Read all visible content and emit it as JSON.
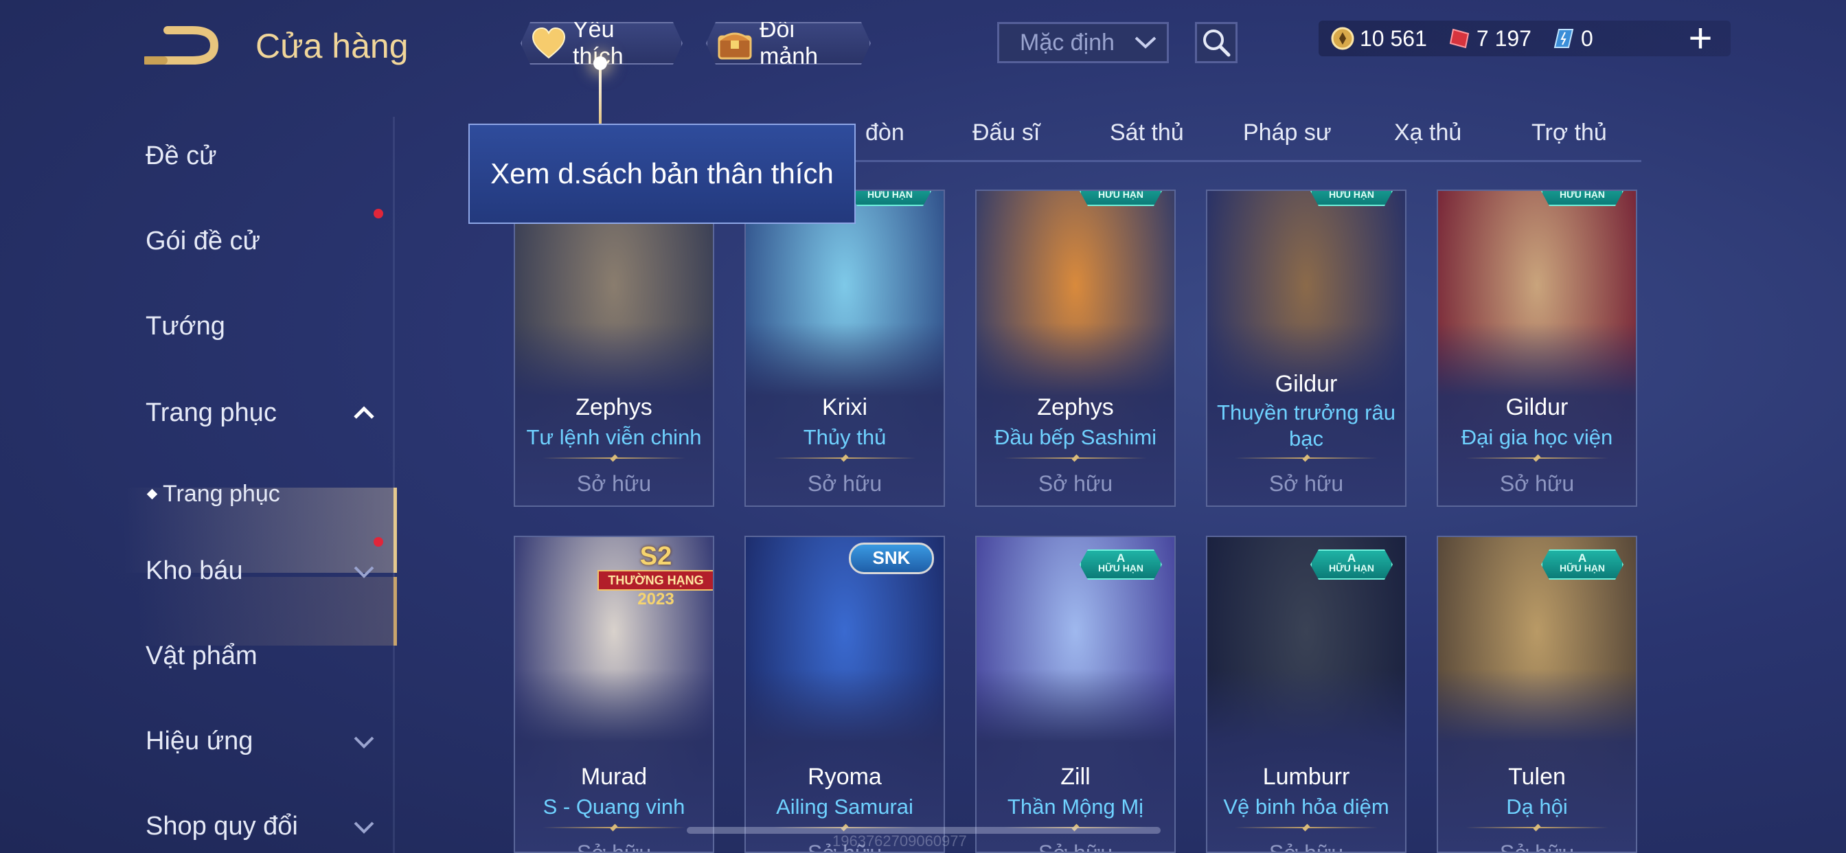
{
  "header": {
    "title": "Cửa hàng",
    "favorites_label": "Yêu thích",
    "exchange_label": "Đổi mảnh",
    "sort_value": "Mặc định"
  },
  "currency": {
    "gold": "10 561",
    "vouchers": "7 197",
    "tokens": "0"
  },
  "sidebar": {
    "items": [
      {
        "label": "Đề cử"
      },
      {
        "label": "Gói đề cử"
      },
      {
        "label": "Tướng"
      },
      {
        "label": "Trang phục"
      },
      {
        "label": "Trang phục"
      },
      {
        "label": "Kho báu"
      },
      {
        "label": "Vật phẩm"
      },
      {
        "label": "Hiệu ứng"
      },
      {
        "label": "Shop quy đổi"
      }
    ]
  },
  "tabs": [
    {
      "label": "đòn"
    },
    {
      "label": "Đấu sĩ"
    },
    {
      "label": "Sát thủ"
    },
    {
      "label": "Pháp sư"
    },
    {
      "label": "Xạ thủ"
    },
    {
      "label": "Trợ thủ"
    }
  ],
  "tooltip": {
    "text": "Xem d.sách bản thân thích"
  },
  "badges": {
    "limited_top": "A",
    "limited_bottom": "HỮU HẠN",
    "event_line1": "S2",
    "event_line2": "THƯỜNG HẠNG",
    "event_line3": "2023",
    "snk": "SNK"
  },
  "cards": [
    {
      "hero": "Zephys",
      "skin": "Tư lệnh viễn chinh",
      "status": "Sở hữu",
      "art": [
        "#8a7d6e",
        "#3a3f55"
      ]
    },
    {
      "hero": "Krixi",
      "skin": "Thủy thủ",
      "status": "Sở hữu",
      "art": [
        "#7ec9e8",
        "#33558e"
      ]
    },
    {
      "hero": "Zephys",
      "skin": "Đầu bếp Sashimi",
      "status": "Sở hữu",
      "art": [
        "#d98a3c",
        "#3b3f66"
      ]
    },
    {
      "hero": "Gildur",
      "skin": "Thuyền trưởng râu bạc",
      "status": "Sở hữu",
      "art": [
        "#8b6a4a",
        "#2b3366"
      ]
    },
    {
      "hero": "Gildur",
      "skin": "Đại gia học viện",
      "status": "Sở hữu",
      "art": [
        "#c9a47c",
        "#7a2a3a"
      ]
    },
    {
      "hero": "Murad",
      "skin": "S - Quang vinh",
      "status": "Sở hữu",
      "art": [
        "#d9d2cc",
        "#3a3f77"
      ]
    },
    {
      "hero": "Ryoma",
      "skin": "Ailing Samurai",
      "status": "Sở hữu",
      "art": [
        "#3a6ad0",
        "#1e2f70"
      ]
    },
    {
      "hero": "Zill",
      "skin": "Thần Mộng Mị",
      "status": "Sở hữu",
      "art": [
        "#9fb8ee",
        "#4a4aa0"
      ]
    },
    {
      "hero": "Lumburr",
      "skin": "Vệ binh hỏa diệm",
      "status": "Sở hữu",
      "art": [
        "#3a4255",
        "#1b2240"
      ]
    },
    {
      "hero": "Tulen",
      "skin": "Dạ hội",
      "status": "Sở hữu",
      "art": [
        "#b99a66",
        "#5a4a3a"
      ]
    }
  ],
  "footer": {
    "uid": "1963762709060977"
  },
  "colors": {
    "accent_gold": "#f1d69a",
    "skin_name": "#6fd2ff",
    "notification": "#e0263a"
  }
}
